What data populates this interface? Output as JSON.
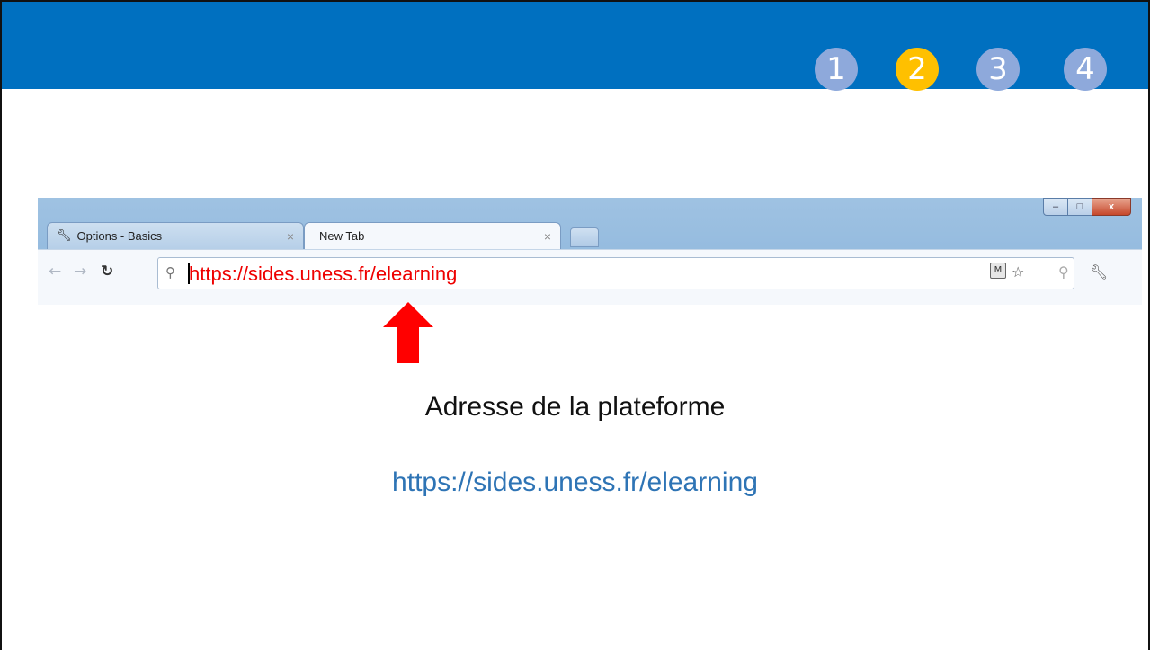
{
  "steps": [
    {
      "label": "1",
      "active": false
    },
    {
      "label": "2",
      "active": true
    },
    {
      "label": "3",
      "active": false
    },
    {
      "label": "4",
      "active": false
    }
  ],
  "colors": {
    "band": "#0070c0",
    "step_inactive": "#8ea9db",
    "step_active": "#ffc000",
    "url_highlight": "#ee0000",
    "link": "#2e74b5",
    "arrow": "#ff0000"
  },
  "browser": {
    "tabs": [
      {
        "label": "Options - Basics",
        "icon": "wrench-icon",
        "close": "×"
      },
      {
        "label": "New Tab",
        "close": "×"
      }
    ],
    "window_controls": {
      "minimize": "–",
      "maximize": "□",
      "close": "x"
    },
    "nav_icons": [
      "back-arrow-icon",
      "forward-arrow-icon",
      "reload-icon"
    ],
    "omnibox": {
      "url": "https://sides.uness.fr/elearning",
      "search_icon": "search-icon"
    },
    "right_icons": [
      "extension-icon",
      "star-icon",
      "search-icon",
      "wrench-icon"
    ]
  },
  "annotation": {
    "caption": "Adresse de la plateforme",
    "link": "https://sides.uness.fr/elearning"
  }
}
